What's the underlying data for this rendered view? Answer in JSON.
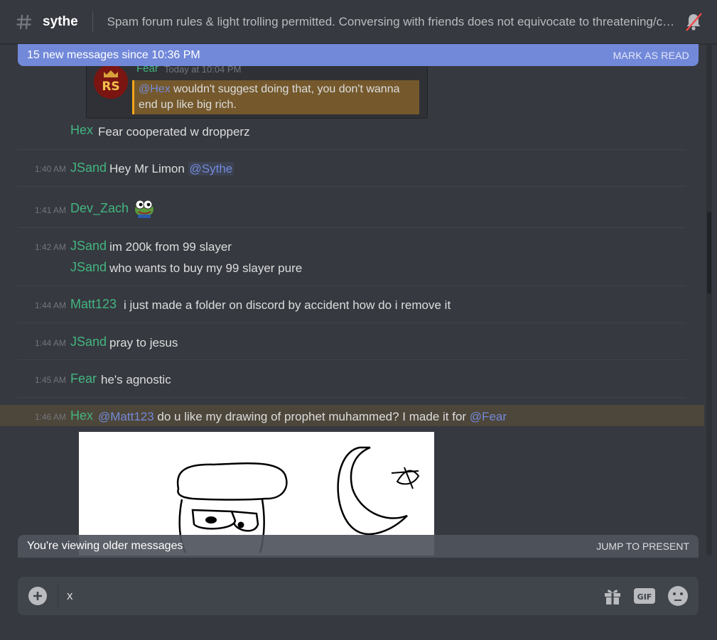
{
  "header": {
    "channel_name": "sythe",
    "topic": "Spam forum rules & light trolling permitted. Conversing with friends does not equivocate to threatening/cons..."
  },
  "new_messages_bar": {
    "text": "15 new messages since 10:36 PM",
    "action": "MARK AS READ"
  },
  "embed": {
    "author": "Fear",
    "time": "Today at 10:04 PM",
    "mention": "@Hex",
    "quote_line1": " wouldn't suggest doing that, you don't wanna",
    "quote_line2": "end up like big rich.",
    "avatar_text": "RS"
  },
  "messages": [
    {
      "username": "Hex",
      "text": "Fear cooperated w dropperz"
    },
    {
      "time": "1:40 AM",
      "username": "JSand",
      "text": "Hey Mr Limon ",
      "mention": "@Sythe"
    },
    {
      "time": "1:41 AM",
      "username": "Dev_Zach"
    },
    {
      "time": "1:42 AM",
      "username": "JSand",
      "text": "im 200k from 99 slayer"
    },
    {
      "username": "JSand",
      "text": "who wants to buy my 99 slayer pure"
    },
    {
      "time": "1:44 AM",
      "username": "Matt123",
      "text": "i just made a folder on discord by accident how do i remove it"
    },
    {
      "time": "1:44 AM",
      "username": "JSand",
      "text": "pray to jesus"
    },
    {
      "time": "1:45 AM",
      "username": "Fear",
      "text": "he's agnostic"
    },
    {
      "time": "1:46 AM",
      "username": "Hex",
      "mention1": "@Matt123",
      "text": " do u like my drawing of prophet muhammed? I made it for ",
      "mention2": "@Fear"
    }
  ],
  "older_bar": {
    "text": "You're viewing older messages",
    "action": "JUMP TO PRESENT"
  },
  "input": {
    "value": "x"
  },
  "colors": {
    "background": "#36393f",
    "accent": "#7289da",
    "username": "#43b581",
    "mention_highlight": "#faa61a"
  }
}
